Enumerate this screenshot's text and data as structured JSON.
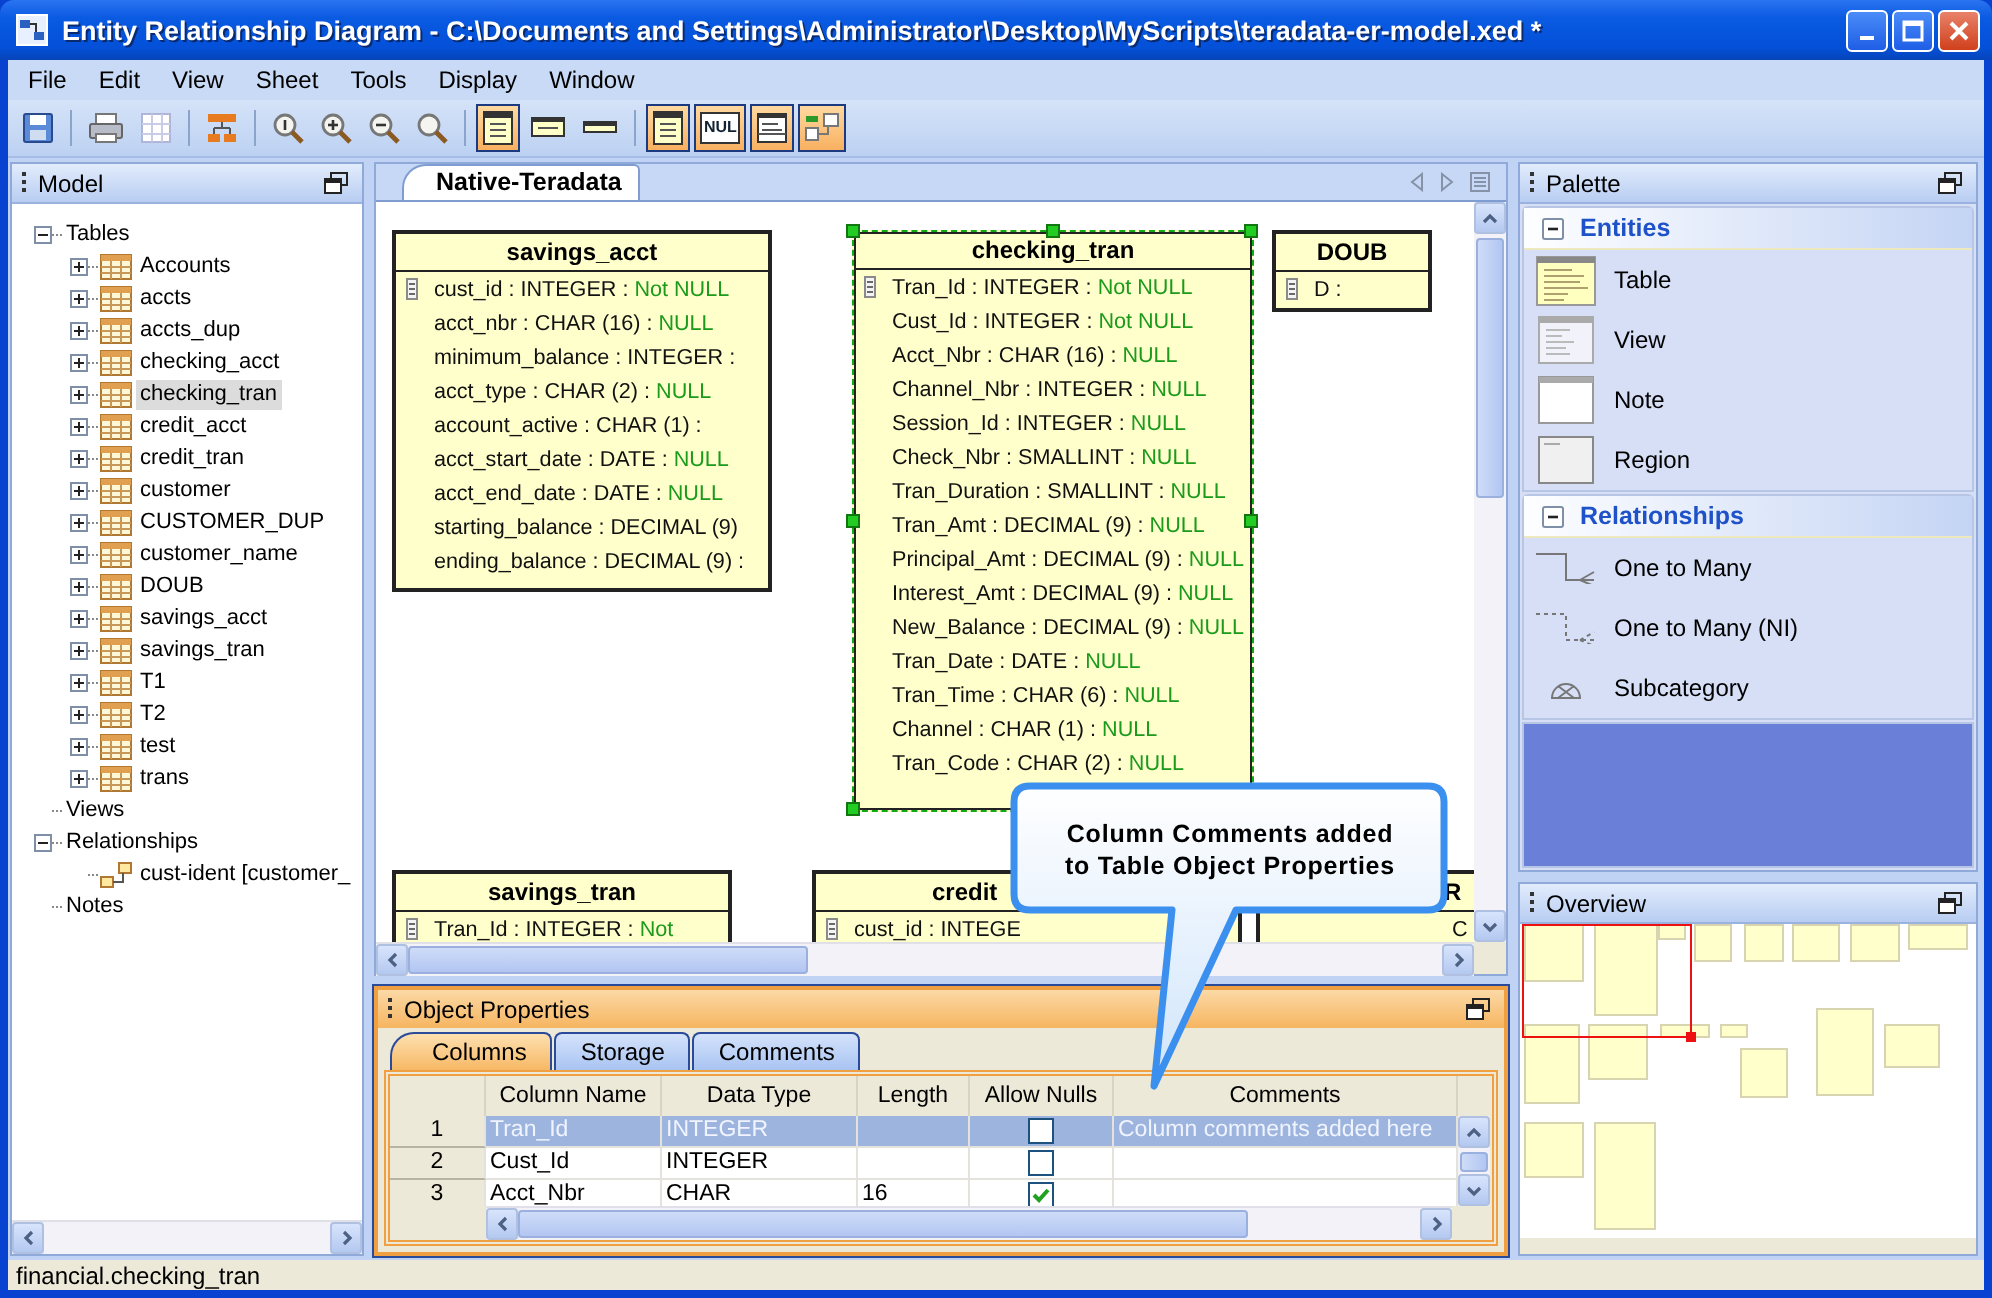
{
  "window": {
    "title": "Entity Relationship Diagram - C:\\Documents and Settings\\Administrator\\Desktop\\MyScripts\\teradata-er-model.xed *"
  },
  "menu": [
    "File",
    "Edit",
    "View",
    "Sheet",
    "Tools",
    "Display",
    "Window"
  ],
  "toolbar": [
    [
      {
        "toggled": false
      }
    ],
    [
      {
        "toggled": false
      },
      {
        "toggled": false
      }
    ],
    [
      {
        "toggled": false
      }
    ],
    [
      {
        "toggled": false
      },
      {
        "toggled": false
      },
      {
        "toggled": false
      },
      {
        "toggled": false
      }
    ],
    [
      {
        "toggled": true
      },
      {
        "toggled": false
      },
      {
        "toggled": false
      }
    ],
    [
      {
        "toggled": true
      },
      {
        "toggled": true,
        "label": "NUL"
      },
      {
        "toggled": true
      },
      {
        "toggled": true
      }
    ]
  ],
  "model": {
    "title": "Model",
    "tree": [
      {
        "label": "Tables",
        "expanded": true,
        "selected": false,
        "children": [
          {
            "label": "Accounts",
            "kind": "table",
            "expanded": false,
            "selected": false
          },
          {
            "label": "accts",
            "kind": "table",
            "expanded": false,
            "selected": false
          },
          {
            "label": "accts_dup",
            "kind": "table",
            "expanded": false,
            "selected": false
          },
          {
            "label": "checking_acct",
            "kind": "table",
            "expanded": false,
            "selected": false
          },
          {
            "label": "checking_tran",
            "kind": "table",
            "expanded": false,
            "selected": true
          },
          {
            "label": "credit_acct",
            "kind": "table",
            "expanded": false,
            "selected": false
          },
          {
            "label": "credit_tran",
            "kind": "table",
            "expanded": false,
            "selected": false
          },
          {
            "label": "customer",
            "kind": "table",
            "expanded": false,
            "selected": false
          },
          {
            "label": "CUSTOMER_DUP",
            "kind": "table",
            "expanded": false,
            "selected": false
          },
          {
            "label": "customer_name",
            "kind": "table",
            "expanded": false,
            "selected": false
          },
          {
            "label": "DOUB",
            "kind": "table",
            "expanded": false,
            "selected": false
          },
          {
            "label": "savings_acct",
            "kind": "table",
            "expanded": false,
            "selected": false
          },
          {
            "label": "savings_tran",
            "kind": "table",
            "expanded": false,
            "selected": false
          },
          {
            "label": "T1",
            "kind": "table",
            "expanded": false,
            "selected": false
          },
          {
            "label": "T2",
            "kind": "table",
            "expanded": false,
            "selected": false
          },
          {
            "label": "test",
            "kind": "table",
            "expanded": false,
            "selected": false
          },
          {
            "label": "trans",
            "kind": "table",
            "expanded": false,
            "selected": false
          }
        ]
      },
      {
        "label": "Views",
        "selected": false
      },
      {
        "label": "Relationships",
        "expanded": true,
        "selected": false,
        "children": [
          {
            "label": "cust-ident [customer_",
            "kind": "relationship",
            "selected": false
          }
        ]
      },
      {
        "label": "Notes",
        "selected": false
      }
    ]
  },
  "diagram": {
    "tabs": [
      {
        "label": "Native-Teradata",
        "selected": true
      }
    ],
    "tables": [
      {
        "name": "savings_acct",
        "selected": false,
        "columns": [
          {
            "text": "cust_id : INTEGER :",
            "null": "Not NULL",
            "key": true
          },
          {
            "text": "acct_nbr : CHAR (16) :",
            "null": "NULL",
            "key": false
          },
          {
            "text": "minimum_balance : INTEGER :",
            "key": false
          },
          {
            "text": "acct_type : CHAR (2) :",
            "null": "NULL",
            "key": false
          },
          {
            "text": "account_active : CHAR (1) :",
            "key": false
          },
          {
            "text": "acct_start_date : DATE :",
            "null": "NULL",
            "key": false
          },
          {
            "text": "acct_end_date : DATE :",
            "null": "NULL",
            "key": false
          },
          {
            "text": "starting_balance : DECIMAL (9)",
            "key": false
          },
          {
            "text": "ending_balance : DECIMAL (9) :",
            "key": false
          }
        ]
      },
      {
        "name": "checking_tran",
        "selected": true,
        "columns": [
          {
            "text": "Tran_Id : INTEGER :",
            "null": "Not NULL",
            "key": true
          },
          {
            "text": "Cust_Id : INTEGER :",
            "null": "Not NULL",
            "key": false
          },
          {
            "text": "Acct_Nbr : CHAR (16) :",
            "null": "NULL",
            "key": false
          },
          {
            "text": "Channel_Nbr : INTEGER :",
            "null": "NULL",
            "key": false
          },
          {
            "text": "Session_Id : INTEGER :",
            "null": "NULL",
            "key": false
          },
          {
            "text": "Check_Nbr : SMALLINT :",
            "null": "NULL",
            "key": false
          },
          {
            "text": "Tran_Duration : SMALLINT :",
            "null": "NULL",
            "key": false
          },
          {
            "text": "Tran_Amt : DECIMAL (9) :",
            "null": "NULL",
            "key": false
          },
          {
            "text": "Principal_Amt : DECIMAL (9) :",
            "null": "NULL",
            "key": false
          },
          {
            "text": "Interest_Amt : DECIMAL (9) :",
            "null": "NULL",
            "key": false
          },
          {
            "text": "New_Balance : DECIMAL (9) :",
            "null": "NULL",
            "key": false
          },
          {
            "text": "Tran_Date : DATE :",
            "null": "NULL",
            "key": false
          },
          {
            "text": "Tran_Time : CHAR (6) :",
            "null": "NULL",
            "key": false
          },
          {
            "text": "Channel : CHAR (1) :",
            "null": "NULL",
            "key": false
          },
          {
            "text": "Tran_Code : CHAR (2) :",
            "null": "NULL",
            "key": false
          }
        ]
      },
      {
        "name": "DOUB",
        "selected": false,
        "columns": [
          {
            "text": "D :",
            "key": true
          }
        ]
      },
      {
        "name": "savings_tran",
        "selected": false,
        "columns": [
          {
            "text": "Tran_Id : INTEGER :",
            "null": "Not",
            "key": true
          }
        ]
      },
      {
        "name": "credit",
        "selected": false,
        "columns": [
          {
            "text": "cust_id : INTEGE",
            "key": true
          }
        ]
      },
      {
        "name": "R",
        "selected": false,
        "columns": [
          {
            "text": "C",
            "key": false
          }
        ]
      }
    ]
  },
  "callout": {
    "lines": [
      "Column Comments added",
      "to Table Object Properties"
    ]
  },
  "properties": {
    "title": "Object Properties",
    "tabs": [
      {
        "label": "Columns",
        "selected": true
      },
      {
        "label": "Storage",
        "selected": false
      },
      {
        "label": "Comments",
        "selected": false
      }
    ],
    "columns": [
      "Column Name",
      "Data Type",
      "Length",
      "Allow Nulls",
      "Comments"
    ],
    "rows": [
      {
        "number": "1",
        "name": "Tran_Id",
        "type": "INTEGER",
        "allow_nulls": false,
        "comment": "Column comments added here",
        "selected": true
      },
      {
        "number": "2",
        "name": "Cust_Id",
        "type": "INTEGER",
        "allow_nulls": false,
        "selected": false
      },
      {
        "number": "3",
        "name": "Acct_Nbr",
        "type": "CHAR",
        "length": "16",
        "allow_nulls": true,
        "selected": false
      }
    ]
  },
  "palette": {
    "title": "Palette",
    "sections": [
      {
        "title": "Entities",
        "expanded": true,
        "items": [
          {
            "label": "Table"
          },
          {
            "label": "View"
          },
          {
            "label": "Note"
          },
          {
            "label": "Region"
          }
        ]
      },
      {
        "title": "Relationships",
        "expanded": true,
        "items": [
          {
            "label": "One to Many"
          },
          {
            "label": "One to Many (NI)"
          },
          {
            "label": "Subcategory"
          }
        ]
      }
    ]
  },
  "overview": {
    "title": "Overview"
  },
  "status_bar": "financial.checking_tran"
}
